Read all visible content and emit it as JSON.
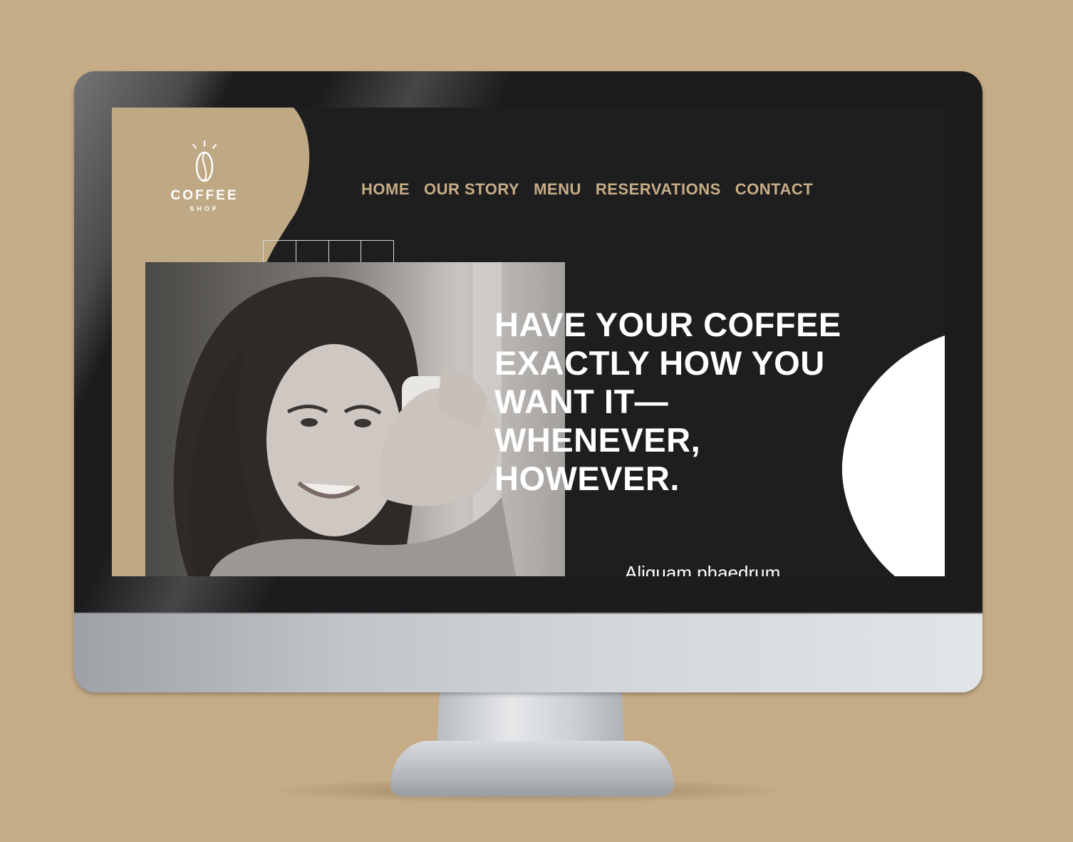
{
  "logo": {
    "name": "COFFEE",
    "subtitle": "SHOP"
  },
  "nav": {
    "items": [
      {
        "label": "HOME"
      },
      {
        "label": "OUR STORY"
      },
      {
        "label": "MENU"
      },
      {
        "label": "RESERVATIONS"
      },
      {
        "label": "CONTACT"
      }
    ]
  },
  "hero": {
    "headline": "HAVE YOUR COFFEE EXACTLY HOW YOU WANT IT—WHENEVER, HOWEVER.",
    "subtext": "Aliquam phaedrum"
  },
  "colors": {
    "background": "#c5ab86",
    "screen": "#1f1e1e",
    "accent_tan": "#bfa985",
    "nav_text": "#c6ad87",
    "text": "#ffffff"
  },
  "icons": {
    "logo": "coffee-bean-icon"
  }
}
